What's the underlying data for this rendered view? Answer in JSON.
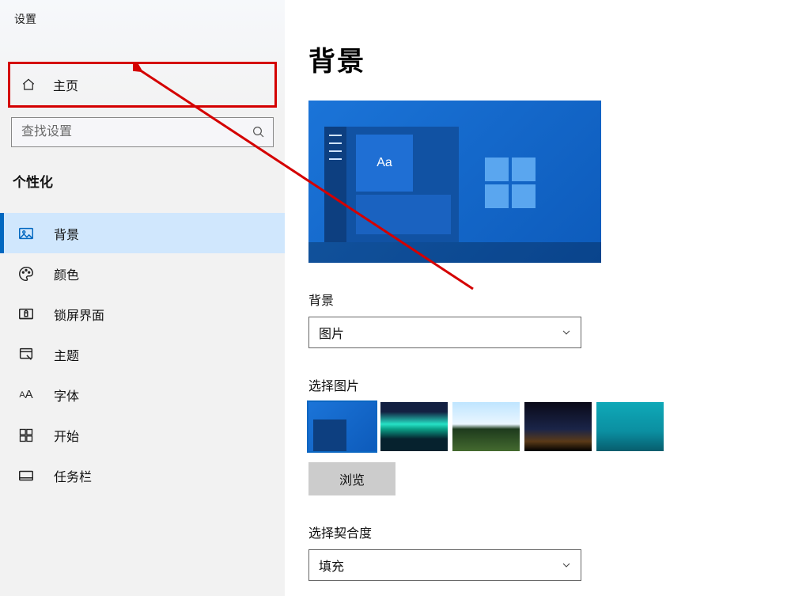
{
  "window": {
    "title": "设置"
  },
  "sidebar": {
    "home_label": "主页",
    "search_placeholder": "查找设置",
    "section": "个性化",
    "items": [
      {
        "label": "背景",
        "name": "sidebar-item-background",
        "active": true
      },
      {
        "label": "颜色",
        "name": "sidebar-item-colors"
      },
      {
        "label": "锁屏界面",
        "name": "sidebar-item-lockscreen"
      },
      {
        "label": "主题",
        "name": "sidebar-item-themes"
      },
      {
        "label": "字体",
        "name": "sidebar-item-fonts"
      },
      {
        "label": "开始",
        "name": "sidebar-item-start"
      },
      {
        "label": "任务栏",
        "name": "sidebar-item-taskbar"
      }
    ]
  },
  "main": {
    "heading": "背景",
    "preview_tile_text": "Aa",
    "bg_label": "背景",
    "bg_value": "图片",
    "choose_label": "选择图片",
    "browse_label": "浏览",
    "fit_label": "选择契合度",
    "fit_value": "填充",
    "thumbnails": [
      {
        "name": "thumb-windows-default",
        "desc": "Windows 10 默认蓝色"
      },
      {
        "name": "thumb-aurora",
        "desc": "极光夜景"
      },
      {
        "name": "thumb-cliff-beach",
        "desc": "海岸悬崖"
      },
      {
        "name": "thumb-night-plain",
        "desc": "夜空平原"
      },
      {
        "name": "thumb-underwater",
        "desc": "水下潜水"
      }
    ]
  },
  "annotation": {
    "highlight": "home-button",
    "color": "#d40000"
  }
}
